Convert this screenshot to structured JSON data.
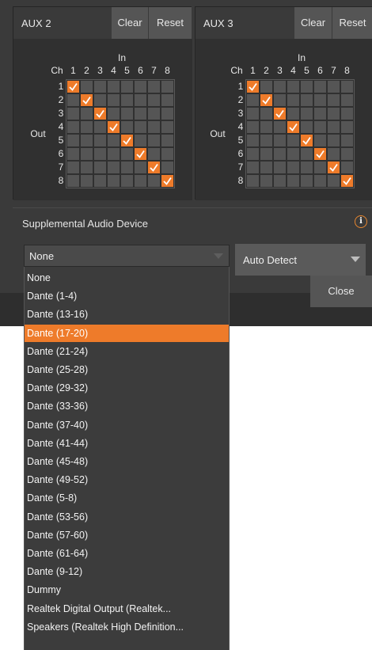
{
  "aux2": {
    "title": "AUX 2",
    "clear": "Clear",
    "reset": "Reset",
    "in_label": "In",
    "ch_label": "Ch",
    "out_label": "Out",
    "cols": [
      "1",
      "2",
      "3",
      "4",
      "5",
      "6",
      "7",
      "8"
    ],
    "rows": [
      "1",
      "2",
      "3",
      "4",
      "5",
      "6",
      "7",
      "8"
    ]
  },
  "aux3": {
    "title": "AUX 3",
    "clear": "Clear",
    "reset": "Reset",
    "in_label": "In",
    "ch_label": "Ch",
    "out_label": "Out",
    "cols": [
      "1",
      "2",
      "3",
      "4",
      "5",
      "6",
      "7",
      "8"
    ],
    "rows": [
      "1",
      "2",
      "3",
      "4",
      "5",
      "6",
      "7",
      "8"
    ]
  },
  "supplemental": {
    "label": "Supplemental Audio Device",
    "info_icon": "info-icon"
  },
  "device_select": {
    "value": "None"
  },
  "mode_select": {
    "value": "Auto Detect"
  },
  "close_label": "Close",
  "dropdown": {
    "selected_index": 3,
    "items": [
      "None",
      "Dante (1-4)",
      "Dante (13-16)",
      "Dante (17-20)",
      "Dante (21-24)",
      "Dante (25-28)",
      "Dante (29-32)",
      "Dante (33-36)",
      "Dante (37-40)",
      "Dante (41-44)",
      "Dante (45-48)",
      "Dante (49-52)",
      "Dante (5-8)",
      "Dante (53-56)",
      "Dante (57-60)",
      "Dante (61-64)",
      "Dante (9-12)",
      "Dummy",
      "Realtek Digital Output (Realtek...",
      "Speakers (Realtek High Definition..."
    ]
  },
  "colors": {
    "accent": "#ee7b2a",
    "cell": "#555555",
    "bg": "#3a3a3a"
  }
}
